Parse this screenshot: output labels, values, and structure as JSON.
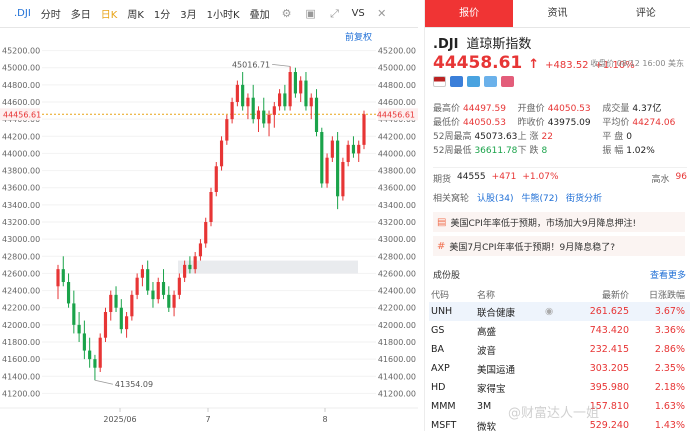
{
  "toolbar": {
    "symbol": ".DJI",
    "items": [
      "分时",
      "多日",
      "日K",
      "周K",
      "1分",
      "3月",
      "1小时K",
      "叠加",
      "VS"
    ]
  },
  "chart": {
    "fuquan": "前复权",
    "y_ticks": [
      "45200.00",
      "45000.00",
      "44800.00",
      "44600.00",
      "44400.00",
      "44200.00",
      "44000.00",
      "43800.00",
      "43600.00",
      "43400.00",
      "43200.00",
      "43000.00",
      "42800.00",
      "42600.00",
      "42400.00",
      "42200.00",
      "42000.00",
      "41800.00",
      "41600.00",
      "41400.00",
      "41200.00"
    ],
    "current_label": "44456.61",
    "x_labels": [
      "2025/06",
      "7",
      "8"
    ],
    "high_label": "45016.71",
    "low_label": "41354.09",
    "up_color": "#e73535",
    "down_color": "#1aa34a"
  },
  "chart_data": {
    "type": "candlestick",
    "ylim": [
      41100,
      45300
    ],
    "candles": [
      [
        42450,
        42700,
        42300,
        42650
      ],
      [
        42650,
        42800,
        42450,
        42500
      ],
      [
        42500,
        42600,
        42200,
        42250
      ],
      [
        42250,
        42400,
        41900,
        42000
      ],
      [
        42000,
        42150,
        41800,
        41900
      ],
      [
        41900,
        42050,
        41600,
        41700
      ],
      [
        41700,
        41850,
        41500,
        41600
      ],
      [
        41600,
        41650,
        41354,
        41500
      ],
      [
        41500,
        41900,
        41450,
        41850
      ],
      [
        41850,
        42200,
        41800,
        42150
      ],
      [
        42150,
        42400,
        42050,
        42350
      ],
      [
        42350,
        42450,
        42150,
        42200
      ],
      [
        42200,
        42300,
        41900,
        41950
      ],
      [
        41950,
        42150,
        41850,
        42100
      ],
      [
        42100,
        42400,
        42050,
        42350
      ],
      [
        42350,
        42600,
        42300,
        42550
      ],
      [
        42550,
        42700,
        42450,
        42650
      ],
      [
        42650,
        42750,
        42350,
        42400
      ],
      [
        42400,
        42500,
        42200,
        42300
      ],
      [
        42300,
        42550,
        42250,
        42500
      ],
      [
        42500,
        42650,
        42300,
        42350
      ],
      [
        42350,
        42450,
        42150,
        42200
      ],
      [
        42200,
        42400,
        42100,
        42350
      ],
      [
        42350,
        42600,
        42300,
        42550
      ],
      [
        42550,
        42750,
        42500,
        42700
      ],
      [
        42700,
        42800,
        42600,
        42650
      ],
      [
        42650,
        42850,
        42600,
        42800
      ],
      [
        42800,
        43000,
        42750,
        42950
      ],
      [
        42950,
        43250,
        42900,
        43200
      ],
      [
        43200,
        43600,
        43150,
        43550
      ],
      [
        43550,
        43900,
        43500,
        43850
      ],
      [
        43850,
        44200,
        43800,
        44150
      ],
      [
        44150,
        44450,
        44100,
        44400
      ],
      [
        44400,
        44650,
        44350,
        44600
      ],
      [
        44600,
        44850,
        44550,
        44800
      ],
      [
        44800,
        44950,
        44500,
        44550
      ],
      [
        44550,
        44700,
        44400,
        44650
      ],
      [
        44650,
        44800,
        44350,
        44400
      ],
      [
        44400,
        44550,
        44250,
        44500
      ],
      [
        44500,
        44650,
        44300,
        44350
      ],
      [
        44350,
        44500,
        44200,
        44450
      ],
      [
        44450,
        44600,
        44300,
        44550
      ],
      [
        44550,
        44750,
        44500,
        44700
      ],
      [
        44700,
        44800,
        44500,
        44550
      ],
      [
        44550,
        45016,
        44500,
        44950
      ],
      [
        44950,
        45000,
        44650,
        44700
      ],
      [
        44700,
        44900,
        44600,
        44850
      ],
      [
        44850,
        44950,
        44500,
        44550
      ],
      [
        44550,
        44700,
        44400,
        44650
      ],
      [
        44650,
        44750,
        44200,
        44250
      ],
      [
        44250,
        44300,
        43600,
        43650
      ],
      [
        43650,
        44000,
        43600,
        43950
      ],
      [
        43950,
        44200,
        43900,
        44150
      ],
      [
        44150,
        44250,
        43350,
        43500
      ],
      [
        43500,
        43950,
        43450,
        43900
      ],
      [
        43900,
        44150,
        43850,
        44100
      ],
      [
        44100,
        44200,
        43950,
        44000
      ],
      [
        44000,
        44150,
        43900,
        44100
      ],
      [
        44100,
        44500,
        44050,
        44457
      ]
    ]
  },
  "tabs": [
    "报价",
    "资讯",
    "评论"
  ],
  "quote": {
    "symbol": ".DJI",
    "name": "道琼斯指数",
    "price": "44458.61",
    "arrow": "↑",
    "change": "+483.52",
    "pct": "+1.10%",
    "close_time": "收盘价 08/12 16:00 美东"
  },
  "stats": [
    [
      [
        "最高价",
        "44497.59",
        "red"
      ],
      [
        "开盘价",
        "44050.53",
        "red"
      ],
      [
        "成交量",
        "4.37亿",
        "dark"
      ]
    ],
    [
      [
        "最低价",
        "44050.53",
        "red"
      ],
      [
        "昨收价",
        "43975.09",
        "dark"
      ],
      [
        "平均价",
        "44274.06",
        "red"
      ]
    ],
    [
      [
        "52周最高",
        "45073.63",
        "dark"
      ],
      [
        "上 涨",
        "22",
        "red"
      ],
      [
        "平 盘",
        "0",
        "dark"
      ]
    ],
    [
      [
        "52周最低",
        "36611.78",
        "green"
      ],
      [
        "下 跌",
        "8",
        "green"
      ],
      [
        "振 幅",
        "1.02%",
        "dark"
      ]
    ]
  ],
  "futures": {
    "label": "期货",
    "price": "44555",
    "change": "+471",
    "pct": "+1.07%",
    "hi_label": "高水",
    "hi_value": "96"
  },
  "warrants": {
    "label": "相关窝轮",
    "call": "认股(34)",
    "bull": "牛熊(72)",
    "analysis": "街货分析"
  },
  "news": [
    "美国CPI年率低于预期，市场加大9月降息押注!",
    "美国7月CPI年率低于预期！9月降息稳了?"
  ],
  "constituents": {
    "title": "成份股",
    "more": "查看更多",
    "headers": [
      "代码",
      "名称",
      "最新价",
      "日涨跌幅"
    ],
    "rows": [
      [
        "UNH",
        "联合健康",
        "261.625",
        "3.67%"
      ],
      [
        "GS",
        "高盛",
        "743.420",
        "3.36%"
      ],
      [
        "BA",
        "波音",
        "232.415",
        "2.86%"
      ],
      [
        "AXP",
        "美国运通",
        "303.205",
        "2.35%"
      ],
      [
        "HD",
        "家得宝",
        "395.980",
        "2.18%"
      ],
      [
        "MMM",
        "3M",
        "157.810",
        "1.63%"
      ],
      [
        "MSFT",
        "微软",
        "529.240",
        "1.43%"
      ]
    ]
  },
  "watermark": "@财富达人一姐"
}
